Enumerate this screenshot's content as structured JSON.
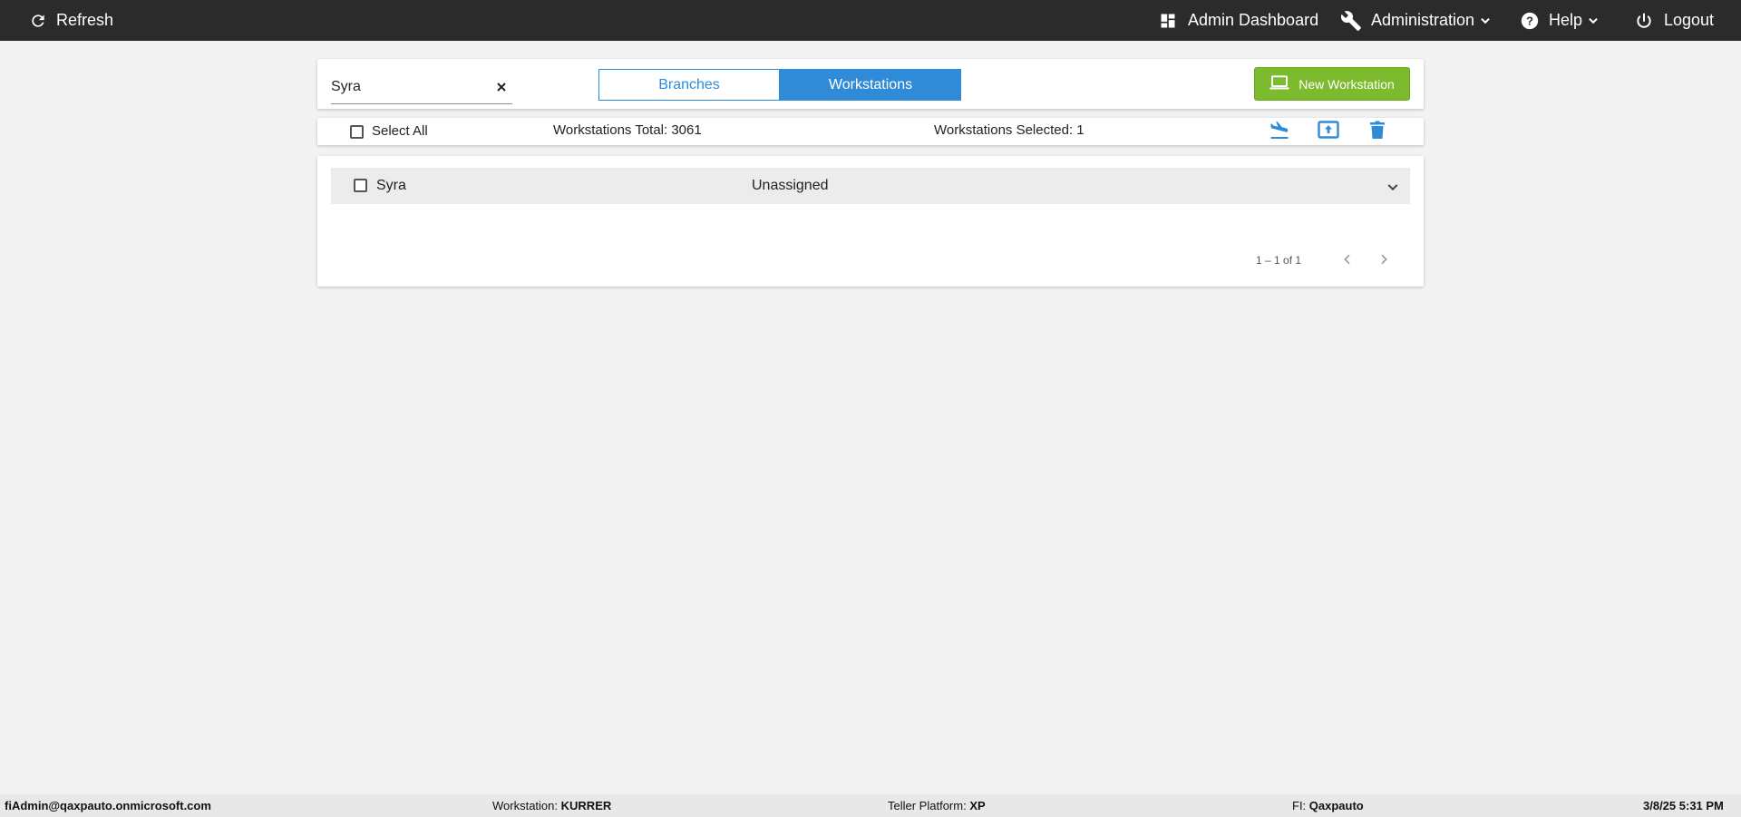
{
  "topbar": {
    "refresh_label": "Refresh",
    "admin_dashboard_label": "Admin Dashboard",
    "administration_label": "Administration",
    "help_label": "Help",
    "logout_label": "Logout"
  },
  "search": {
    "value": "Syra",
    "placeholder": ""
  },
  "tabs": {
    "branches": "Branches",
    "workstations": "Workstations",
    "active": "Workstations"
  },
  "new_workstation_label": "New Workstation",
  "toolbar": {
    "select_all_label": "Select All",
    "workstations_total": "Workstations Total: 3061",
    "workstations_selected": "Workstations Selected: 1",
    "actions": [
      "move-icon",
      "upload-icon",
      "delete-icon"
    ]
  },
  "list": {
    "rows": [
      {
        "name": "Syra",
        "status": "Unassigned",
        "checked": false
      }
    ]
  },
  "pagination": {
    "range": "1 – 1 of 1"
  },
  "footer": {
    "user": "fiAdmin@qaxpauto.onmicrosoft.com",
    "workstation_label": "Workstation:",
    "workstation_value": "KURRER",
    "teller_platform_label": "Teller Platform:",
    "teller_platform_value": "XP",
    "fi_label": "FI:",
    "fi_value": "Qaxpauto",
    "datetime": "3/8/25 5:31 PM"
  },
  "colors": {
    "topbar": "#2b2b2b",
    "accent_blue": "#2f8ad8",
    "green_button": "#7dbb2e",
    "background": "#f2f2f2"
  }
}
